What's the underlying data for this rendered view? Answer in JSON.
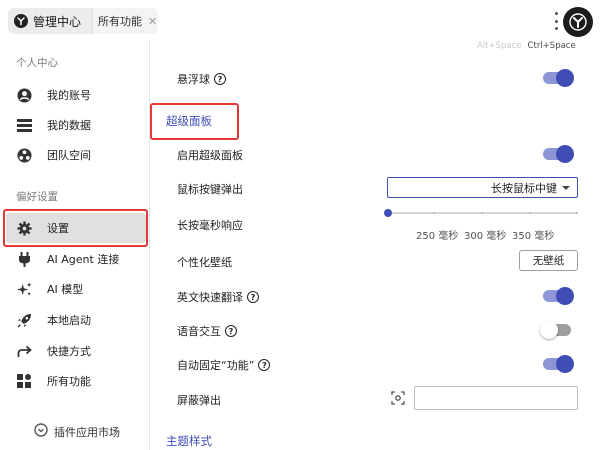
{
  "topbar": {
    "home_tab_label": "管理中心",
    "all_features_tab_label": "所有功能",
    "close_glyph": "✕"
  },
  "sidebar": {
    "section_personal": "个人中心",
    "items_personal": [
      {
        "label": "我的账号",
        "icon": "account-circle-icon"
      },
      {
        "label": "我的数据",
        "icon": "data-list-icon"
      },
      {
        "label": "团队空间",
        "icon": "team-space-icon"
      }
    ],
    "section_preferences": "偏好设置",
    "items_preferences": [
      {
        "label": "设置",
        "icon": "gear-icon",
        "active": true
      },
      {
        "label": "AI Agent 连接",
        "icon": "plug-icon"
      },
      {
        "label": "AI 模型",
        "icon": "sparkles-icon"
      },
      {
        "label": "本地启动",
        "icon": "rocket-icon"
      },
      {
        "label": "快捷方式",
        "icon": "shortcut-arrow-icon"
      },
      {
        "label": "所有功能",
        "icon": "apps-grid-icon"
      }
    ],
    "plugin_market_label": "插件应用市场"
  },
  "main": {
    "hotkey_hint_1": "Alt+Space",
    "hotkey_hint_2": "Ctrl+Space",
    "floating_ball_label": "悬浮球",
    "super_panel_heading": "超级面板",
    "enable_super_panel_label": "启用超级面板",
    "mouse_key_popup_label": "鼠标按键弹出",
    "mouse_key_popup_value": "长按鼠标中键",
    "long_press_label": "长按毫秒响应",
    "long_press_ticks": [
      "250 毫秒",
      "300 毫秒",
      "350 毫秒"
    ],
    "wallpaper_label": "个性化壁纸",
    "wallpaper_button": "无壁纸",
    "quick_translate_label": "英文快速翻译",
    "voice_label": "语音交互",
    "auto_pin_label": "自动固定“功能”",
    "mask_popup_label": "屏蔽弹出",
    "theme_heading": "主题样式"
  },
  "toggles": {
    "floating_ball": true,
    "enable_super_panel": true,
    "quick_translate": true,
    "voice": false,
    "auto_pin": true
  },
  "long_press_slider_value": 0,
  "colors": {
    "accent": "#3f4db5",
    "highlight_box": "#e53935"
  }
}
